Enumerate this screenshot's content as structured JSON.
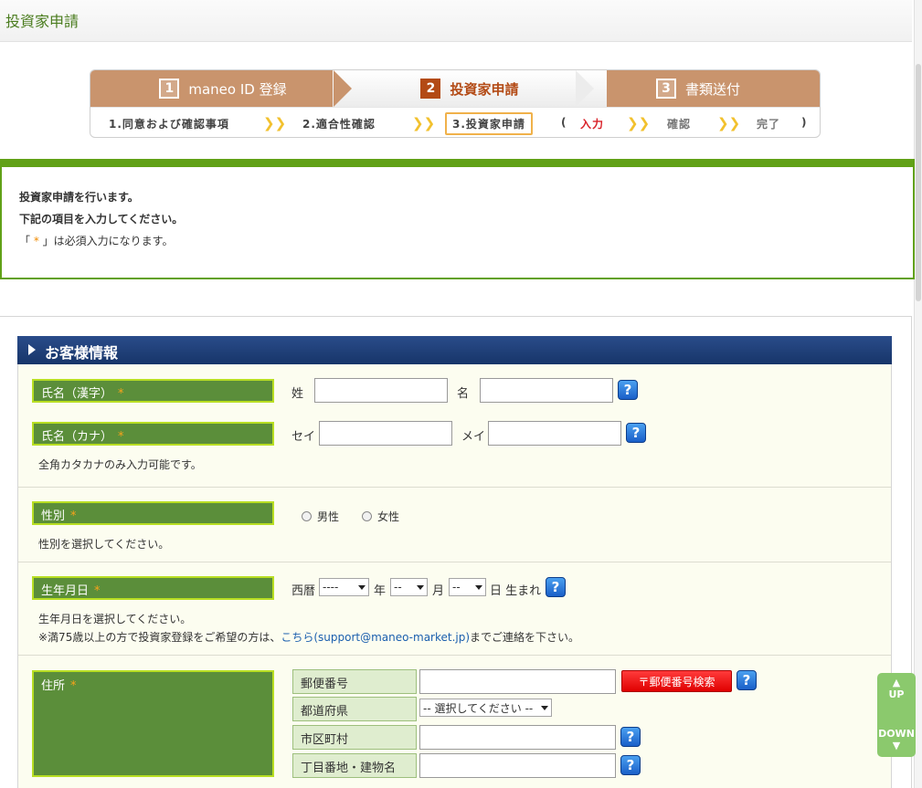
{
  "header": {
    "title": "投資家申請"
  },
  "stepper": {
    "steps": [
      {
        "num": "1",
        "label": "maneo ID 登録"
      },
      {
        "num": "2",
        "label": "投資家申請"
      },
      {
        "num": "3",
        "label": "書類送付"
      }
    ],
    "substeps": {
      "s1": "1.同意および確認事項",
      "s2": "2.適合性確認",
      "s3": "3.投資家申請",
      "paren_open": "(",
      "input": "入力",
      "confirm": "確認",
      "done": "完了",
      "paren_close": ")"
    }
  },
  "notice": {
    "line1": "投資家申請を行います。",
    "line2": "下記の項目を入力してください。",
    "line3_pre": "「",
    "line3_star": " * ",
    "line3_post": "」は必須入力になります。"
  },
  "section": {
    "title": "お客様情報",
    "name_kanji": {
      "label": "氏名（漢字）",
      "req": "*",
      "sei": "姓",
      "mei": "名"
    },
    "name_kana": {
      "label": "氏名（カナ）",
      "req": "*",
      "sei": "セイ",
      "mei": "メイ",
      "hint": "全角カタカナのみ入力可能です。"
    },
    "gender": {
      "label": "性別",
      "req": "*",
      "male": "男性",
      "female": "女性",
      "hint": "性別を選択してください。"
    },
    "birth": {
      "label": "生年月日",
      "req": "*",
      "era": "西暦",
      "year_value": "----",
      "year_unit": "年",
      "month_value": "--",
      "month_unit": "月",
      "day_value": "--",
      "day_unit": "日 生まれ",
      "hint1": "生年月日を選択してください。",
      "hint2_pre": "※満75歳以上の方で投資家登録をご希望の方は、",
      "hint2_link": "こちら(support@maneo-market.jp)",
      "hint2_post": "までご連絡を下さい。"
    },
    "address": {
      "label": "住所",
      "req": "*",
      "zip": "郵便番号",
      "zip_search": "〒郵便番号検索",
      "pref": "都道府県",
      "pref_value": "-- 選択してください --",
      "city": "市区町村",
      "street": "丁目番地・建物名"
    }
  },
  "help_glyph": "?",
  "updown": {
    "up": "UP",
    "down": "DOWN",
    "up_arrow": "▲",
    "down_arrow": "▼"
  },
  "colors": {
    "accent_green": "#61a117",
    "label_green": "#5b8e3a",
    "navy": "#173569",
    "step_brown": "#c9946d",
    "step_active": "#b34a15",
    "link": "#1b5fae",
    "required": "#f7a21b"
  }
}
